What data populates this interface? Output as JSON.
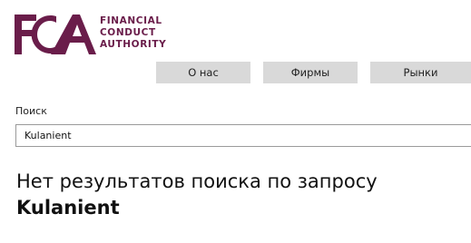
{
  "brand": {
    "logo_letters": "FCA",
    "logo_line1": "FINANCIAL",
    "logo_line2": "CONDUCT",
    "logo_line3": "AUTHORITY",
    "color": "#6a1d4a"
  },
  "nav": {
    "items": [
      {
        "label": "О нас"
      },
      {
        "label": "Фирмы"
      },
      {
        "label": "Рынки"
      }
    ],
    "background": "#d9d9d9"
  },
  "search": {
    "label": "Поиск",
    "value": "Kulanient"
  },
  "results": {
    "message": "Нет результатов поиска по запросу",
    "query": "Kulanient"
  }
}
